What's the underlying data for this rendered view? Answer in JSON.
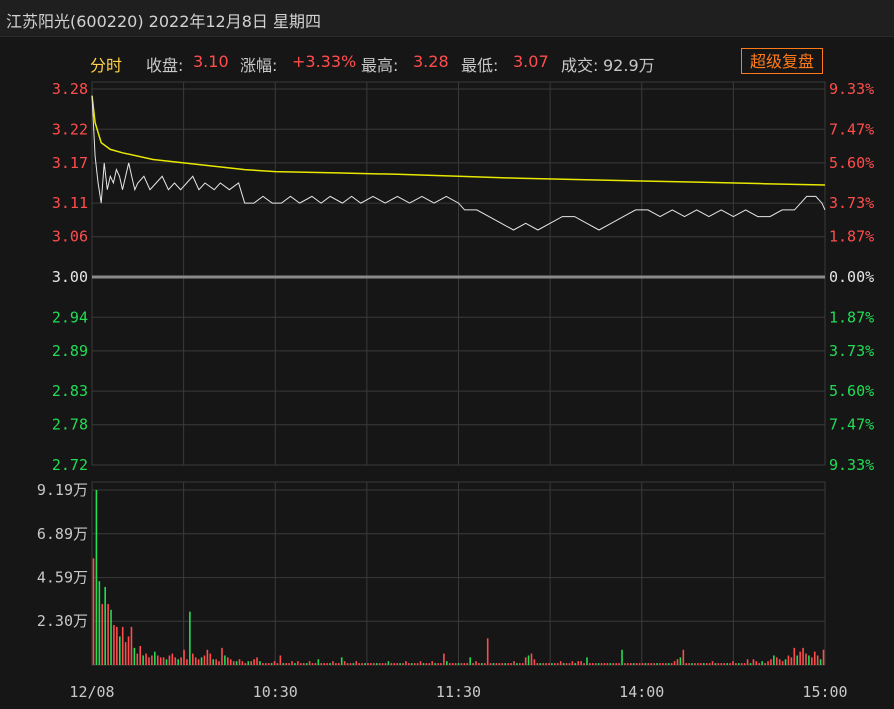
{
  "header": {
    "title": "江苏阳光(600220) 2022年12月8日 星期四"
  },
  "info": {
    "tab": "分时",
    "close_label": "收盘:",
    "close_value": "3.10",
    "change_label": "涨幅:",
    "change_value": "+3.33%",
    "high_label": "最高:",
    "high_value": "3.28",
    "low_label": "最低:",
    "low_value": "3.07",
    "volume_label": "成交:",
    "volume_value": "92.9万",
    "fq_button": "超级复盘"
  },
  "colors": {
    "up": "#ff4d4d",
    "down": "#22dd55",
    "price_line": "#e6e6e6",
    "avg_line": "#e8e800",
    "grid": "#3a3a3a"
  },
  "chart_data": {
    "type": "line",
    "prev_close": 3.0,
    "price_axis": {
      "ylim": [
        2.72,
        3.28
      ],
      "ticks": [
        {
          "value": 3.28,
          "label": "3.28",
          "pct": "9.33%",
          "dir": "up"
        },
        {
          "value": 3.22,
          "label": "3.22",
          "pct": "7.47%",
          "dir": "up"
        },
        {
          "value": 3.17,
          "label": "3.17",
          "pct": "5.60%",
          "dir": "up"
        },
        {
          "value": 3.11,
          "label": "3.11",
          "pct": "3.73%",
          "dir": "up"
        },
        {
          "value": 3.06,
          "label": "3.06",
          "pct": "1.87%",
          "dir": "up"
        },
        {
          "value": 3.0,
          "label": "3.00",
          "pct": "0.00%",
          "dir": "flat"
        },
        {
          "value": 2.94,
          "label": "2.94",
          "pct": "1.87%",
          "dir": "down"
        },
        {
          "value": 2.89,
          "label": "2.89",
          "pct": "3.73%",
          "dir": "down"
        },
        {
          "value": 2.83,
          "label": "2.83",
          "pct": "5.60%",
          "dir": "down"
        },
        {
          "value": 2.78,
          "label": "2.78",
          "pct": "7.47%",
          "dir": "down"
        },
        {
          "value": 2.72,
          "label": "2.72",
          "pct": "9.33%",
          "dir": "down"
        }
      ]
    },
    "volume_axis": {
      "ylim": [
        0,
        9.19
      ],
      "ticks": [
        {
          "value": 9.19,
          "label": "9.19万"
        },
        {
          "value": 6.89,
          "label": "6.89万"
        },
        {
          "value": 4.59,
          "label": "4.59万"
        },
        {
          "value": 2.3,
          "label": "2.30万"
        }
      ]
    },
    "x_axis": {
      "minutes": 240,
      "labels": [
        {
          "minute": 0,
          "label": "12/08"
        },
        {
          "minute": 60,
          "label": "10:30"
        },
        {
          "minute": 120,
          "label": "11:30"
        },
        {
          "minute": 180,
          "label": "14:00"
        },
        {
          "minute": 240,
          "label": "15:00"
        }
      ]
    },
    "series": [
      {
        "key": "price",
        "points": [
          [
            0,
            3.27
          ],
          [
            1,
            3.18
          ],
          [
            2,
            3.14
          ],
          [
            3,
            3.11
          ],
          [
            4,
            3.17
          ],
          [
            5,
            3.13
          ],
          [
            6,
            3.15
          ],
          [
            7,
            3.14
          ],
          [
            8,
            3.16
          ],
          [
            9,
            3.15
          ],
          [
            10,
            3.13
          ],
          [
            11,
            3.15
          ],
          [
            12,
            3.17
          ],
          [
            13,
            3.15
          ],
          [
            14,
            3.13
          ],
          [
            15,
            3.14
          ],
          [
            17,
            3.15
          ],
          [
            19,
            3.13
          ],
          [
            21,
            3.14
          ],
          [
            23,
            3.15
          ],
          [
            25,
            3.13
          ],
          [
            27,
            3.14
          ],
          [
            29,
            3.13
          ],
          [
            31,
            3.14
          ],
          [
            33,
            3.15
          ],
          [
            35,
            3.13
          ],
          [
            37,
            3.14
          ],
          [
            40,
            3.13
          ],
          [
            42,
            3.14
          ],
          [
            45,
            3.13
          ],
          [
            48,
            3.14
          ],
          [
            50,
            3.11
          ],
          [
            53,
            3.11
          ],
          [
            56,
            3.12
          ],
          [
            59,
            3.11
          ],
          [
            62,
            3.11
          ],
          [
            65,
            3.12
          ],
          [
            68,
            3.11
          ],
          [
            72,
            3.12
          ],
          [
            75,
            3.11
          ],
          [
            78,
            3.12
          ],
          [
            82,
            3.11
          ],
          [
            85,
            3.12
          ],
          [
            88,
            3.11
          ],
          [
            92,
            3.12
          ],
          [
            96,
            3.11
          ],
          [
            100,
            3.12
          ],
          [
            104,
            3.11
          ],
          [
            108,
            3.12
          ],
          [
            112,
            3.11
          ],
          [
            116,
            3.12
          ],
          [
            120,
            3.11
          ],
          [
            122,
            3.1
          ],
          [
            126,
            3.1
          ],
          [
            130,
            3.09
          ],
          [
            134,
            3.08
          ],
          [
            138,
            3.07
          ],
          [
            142,
            3.08
          ],
          [
            146,
            3.07
          ],
          [
            150,
            3.08
          ],
          [
            154,
            3.09
          ],
          [
            158,
            3.09
          ],
          [
            162,
            3.08
          ],
          [
            166,
            3.07
          ],
          [
            170,
            3.08
          ],
          [
            174,
            3.09
          ],
          [
            178,
            3.1
          ],
          [
            182,
            3.1
          ],
          [
            186,
            3.09
          ],
          [
            190,
            3.1
          ],
          [
            194,
            3.09
          ],
          [
            198,
            3.1
          ],
          [
            202,
            3.09
          ],
          [
            206,
            3.1
          ],
          [
            210,
            3.09
          ],
          [
            214,
            3.1
          ],
          [
            218,
            3.09
          ],
          [
            222,
            3.09
          ],
          [
            226,
            3.1
          ],
          [
            230,
            3.1
          ],
          [
            234,
            3.12
          ],
          [
            237,
            3.12
          ],
          [
            239,
            3.11
          ],
          [
            240,
            3.1
          ]
        ]
      },
      {
        "key": "average",
        "points": [
          [
            0,
            3.27
          ],
          [
            1,
            3.23
          ],
          [
            3,
            3.2
          ],
          [
            6,
            3.19
          ],
          [
            10,
            3.185
          ],
          [
            20,
            3.175
          ],
          [
            30,
            3.17
          ],
          [
            40,
            3.165
          ],
          [
            50,
            3.16
          ],
          [
            60,
            3.157
          ],
          [
            80,
            3.155
          ],
          [
            100,
            3.153
          ],
          [
            120,
            3.15
          ],
          [
            140,
            3.147
          ],
          [
            160,
            3.145
          ],
          [
            180,
            3.143
          ],
          [
            200,
            3.141
          ],
          [
            220,
            3.139
          ],
          [
            240,
            3.137
          ]
        ]
      }
    ],
    "volume": {
      "values": [
        5.6,
        9.19,
        4.4,
        3.2,
        4.1,
        3.2,
        2.9,
        2.1,
        2.0,
        1.5,
        2.0,
        1.2,
        1.5,
        2.0,
        0.9,
        0.6,
        1.0,
        0.5,
        0.6,
        0.4,
        0.5,
        0.7,
        0.5,
        0.4,
        0.4,
        0.3,
        0.5,
        0.6,
        0.4,
        0.3,
        0.4,
        0.8,
        0.3,
        2.8,
        0.6,
        0.4,
        0.3,
        0.4,
        0.5,
        0.8,
        0.6,
        0.3,
        0.3,
        0.2,
        0.9,
        0.5,
        0.4,
        0.3,
        0.2,
        0.2,
        0.3,
        0.2,
        0.1,
        0.2,
        0.2,
        0.3,
        0.4,
        0.2,
        0.1,
        0.1,
        0.1,
        0.1,
        0.2,
        0.1,
        0.5,
        0.1,
        0.1,
        0.1,
        0.2,
        0.1,
        0.2,
        0.1,
        0.1,
        0.1,
        0.2,
        0.1,
        0.1,
        0.3,
        0.1,
        0.1,
        0.1,
        0.1,
        0.2,
        0.1,
        0.1,
        0.4,
        0.2,
        0.1,
        0.1,
        0.1,
        0.2,
        0.1,
        0.1,
        0.1,
        0.1,
        0.1,
        0.1,
        0.1,
        0.1,
        0.1,
        0.1,
        0.2,
        0.1,
        0.1,
        0.1,
        0.1,
        0.1,
        0.2,
        0.1,
        0.1,
        0.1,
        0.1,
        0.2,
        0.1,
        0.1,
        0.1,
        0.2,
        0.1,
        0.1,
        0.1,
        0.6,
        0.2,
        0.1,
        0.1,
        0.1,
        0.1,
        0.1,
        0.1,
        0.1,
        0.4,
        0.1,
        0.2,
        0.1,
        0.1,
        0.1,
        1.4,
        0.1,
        0.1,
        0.1,
        0.1,
        0.1,
        0.1,
        0.1,
        0.1,
        0.2,
        0.1,
        0.1,
        0.1,
        0.4,
        0.5,
        0.6,
        0.3,
        0.1,
        0.1,
        0.1,
        0.1,
        0.1,
        0.1,
        0.1,
        0.1,
        0.2,
        0.1,
        0.1,
        0.1,
        0.2,
        0.1,
        0.2,
        0.2,
        0.1,
        0.4,
        0.1,
        0.1,
        0.1,
        0.1,
        0.1,
        0.1,
        0.1,
        0.1,
        0.1,
        0.1,
        0.1,
        0.8,
        0.1,
        0.1,
        0.1,
        0.1,
        0.1,
        0.1,
        0.1,
        0.1,
        0.1,
        0.1,
        0.1,
        0.1,
        0.1,
        0.1,
        0.1,
        0.1,
        0.1,
        0.2,
        0.3,
        0.4,
        0.8,
        0.1,
        0.1,
        0.1,
        0.1,
        0.1,
        0.1,
        0.1,
        0.1,
        0.1,
        0.2,
        0.1,
        0.1,
        0.1,
        0.1,
        0.1,
        0.1,
        0.2,
        0.1,
        0.1,
        0.1,
        0.1,
        0.3,
        0.1,
        0.3,
        0.2,
        0.1,
        0.2,
        0.1,
        0.2,
        0.3,
        0.5,
        0.4,
        0.3,
        0.2,
        0.3,
        0.5,
        0.4,
        0.9,
        0.5,
        0.7,
        0.9,
        0.6,
        0.5,
        0.4,
        0.7,
        0.5,
        0.3,
        0.8
      ],
      "direction": [
        "up",
        "down",
        "down",
        "up",
        "down",
        "up",
        "down",
        "up",
        "up",
        "down",
        "up",
        "up",
        "up",
        "up",
        "down",
        "up",
        "up",
        "down",
        "up",
        "up",
        "up",
        "down",
        "up",
        "up",
        "up",
        "down",
        "up",
        "up",
        "up",
        "down",
        "up",
        "up",
        "up",
        "down",
        "up",
        "up",
        "up",
        "down",
        "up",
        "up",
        "up",
        "down",
        "up",
        "up",
        "up",
        "down",
        "up",
        "up",
        "up",
        "down",
        "up",
        "up",
        "up",
        "down",
        "up",
        "up",
        "up",
        "down",
        "up",
        "up",
        "up",
        "down",
        "up",
        "up",
        "up",
        "down",
        "up",
        "up",
        "up",
        "down",
        "up",
        "up",
        "up",
        "down",
        "up",
        "up",
        "up",
        "down",
        "up",
        "up",
        "up",
        "down",
        "up",
        "up",
        "up",
        "down",
        "up",
        "up",
        "up",
        "down",
        "up",
        "up",
        "up",
        "down",
        "up",
        "up",
        "up",
        "down",
        "up",
        "up",
        "up",
        "down",
        "up",
        "up",
        "up",
        "down",
        "up",
        "up",
        "up",
        "down",
        "up",
        "up",
        "up",
        "down",
        "up",
        "up",
        "up",
        "down",
        "up",
        "up",
        "up",
        "down",
        "up",
        "up",
        "up",
        "down",
        "up",
        "up",
        "up",
        "down",
        "up",
        "up",
        "up",
        "down",
        "up",
        "up",
        "up",
        "down",
        "up",
        "up",
        "up",
        "down",
        "up",
        "up",
        "up",
        "down",
        "up",
        "up",
        "up",
        "down",
        "up",
        "up",
        "up",
        "down",
        "up",
        "up",
        "up",
        "down",
        "up",
        "up",
        "up",
        "down",
        "up",
        "up",
        "up",
        "down",
        "up",
        "up",
        "up",
        "down",
        "up",
        "up",
        "up",
        "down",
        "up",
        "up",
        "up",
        "down",
        "up",
        "up",
        "up",
        "down",
        "up",
        "up",
        "up",
        "down",
        "up",
        "up",
        "up",
        "down",
        "up",
        "up",
        "up",
        "down",
        "up",
        "up",
        "up",
        "down",
        "up",
        "up",
        "up",
        "down",
        "up",
        "up",
        "up",
        "down",
        "up",
        "up",
        "up",
        "down",
        "up",
        "up",
        "up",
        "down",
        "up",
        "up",
        "up",
        "down",
        "up",
        "up",
        "up",
        "down",
        "up",
        "up",
        "up",
        "down",
        "up",
        "up",
        "up",
        "down",
        "up",
        "up",
        "up",
        "down",
        "up",
        "up",
        "up",
        "down",
        "up",
        "up",
        "up",
        "down",
        "up",
        "up",
        "up",
        "down",
        "up",
        "up",
        "up",
        "down",
        "up",
        "up",
        "up",
        "down"
      ]
    }
  }
}
